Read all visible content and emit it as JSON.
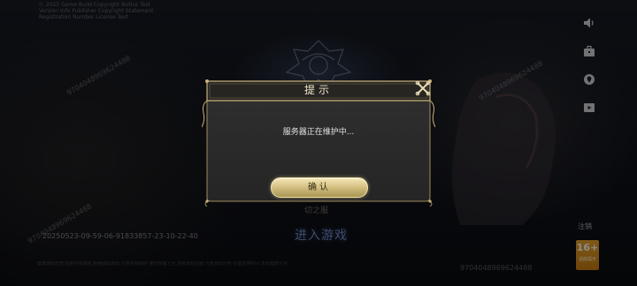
{
  "background": {
    "info_lines": [
      "Ⓒ 2025 Game Build Copyright Notice Text",
      "Version Info Publisher Copyright Statement",
      "Registration Number License Text"
    ],
    "watermark": "9704048969624488",
    "timestamp": "20250523-09-59-06-91833857-23-10-22-40",
    "enter_game_label": "进入游戏",
    "behind_dialog_text": "切之服",
    "footer_text": "健康游戏忠告 抵制不良游戏 拒绝盗版游戏 注意自我保护 谨防受骗上当 适度游戏益脑 沉迷游戏伤身 合理安排时间 享受健康生活"
  },
  "side_menu": {
    "items": [
      {
        "icon": "speaker-icon"
      },
      {
        "icon": "briefcase-icon"
      },
      {
        "icon": "location-pin-icon"
      },
      {
        "icon": "video-icon"
      }
    ],
    "logout_label": "注销"
  },
  "age_rating": {
    "value": "16+",
    "label": "适龄提示",
    "color": "#e8a22a"
  },
  "dialog": {
    "title": "提示",
    "message": "服务器正在维护中...",
    "confirm_label": "确认",
    "close_icon": "close-icon",
    "accent_color": "#c9b27a"
  }
}
